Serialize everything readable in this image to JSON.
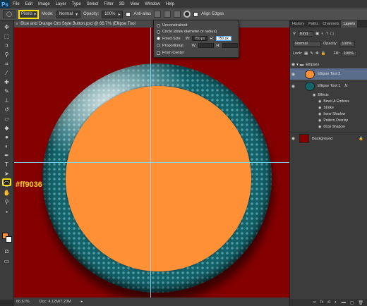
{
  "app": {
    "logo": "Ps"
  },
  "menu": [
    "File",
    "Edit",
    "Image",
    "Layer",
    "Type",
    "Select",
    "Filter",
    "3D",
    "View",
    "Window",
    "Help"
  ],
  "options": {
    "units": "Pixels",
    "mode_label": "Mode:",
    "mode_value": "Normal",
    "opacity_label": "Opacity:",
    "opacity_value": "100%",
    "antialias_label": "Anti-alias",
    "align_edges_label": "Align Edges"
  },
  "document": {
    "title": "Blue and Orange Orb Style Button.psd @ 66.7% (Ellipse Tool"
  },
  "popup": {
    "unconstrained": "Unconstrained",
    "circle": "Circle (draw diameter or radius)",
    "fixed_size": "Fixed Size",
    "w_label": "W:",
    "w_value": "750 px",
    "h_label": "H:",
    "h_value": "750 px",
    "proportional": "Proportional",
    "from_center": "From Center"
  },
  "annotation": {
    "color_hex": "#ff9036"
  },
  "status": {
    "zoom": "66.67%",
    "doc": "Doc: 4.12M/7.20M"
  },
  "panel": {
    "tabs": [
      "History",
      "Paths",
      "Channels",
      "Layers"
    ],
    "active_tab": "Layers",
    "kind_label": "Kind",
    "blend": "Normal",
    "opacity_label": "Opacity:",
    "opacity_value": "100%",
    "lock_label": "Lock:",
    "fill_label": "Fill:",
    "fill_value": "100%",
    "group_name": "Ellipses",
    "layers": [
      "Ellipse Tool 2",
      "Ellipse Tool 1"
    ],
    "fx_label": "fx",
    "effects_label": "Effects",
    "effects": [
      "Bevel & Emboss",
      "Stroke",
      "Inner Shadow",
      "Pattern Overlay",
      "Drop Shadow"
    ],
    "background": "Background"
  },
  "colors": {
    "orange": "#ff9036",
    "canvas": "#850100",
    "teal": "#14636b",
    "highlight": "#ffe000"
  }
}
